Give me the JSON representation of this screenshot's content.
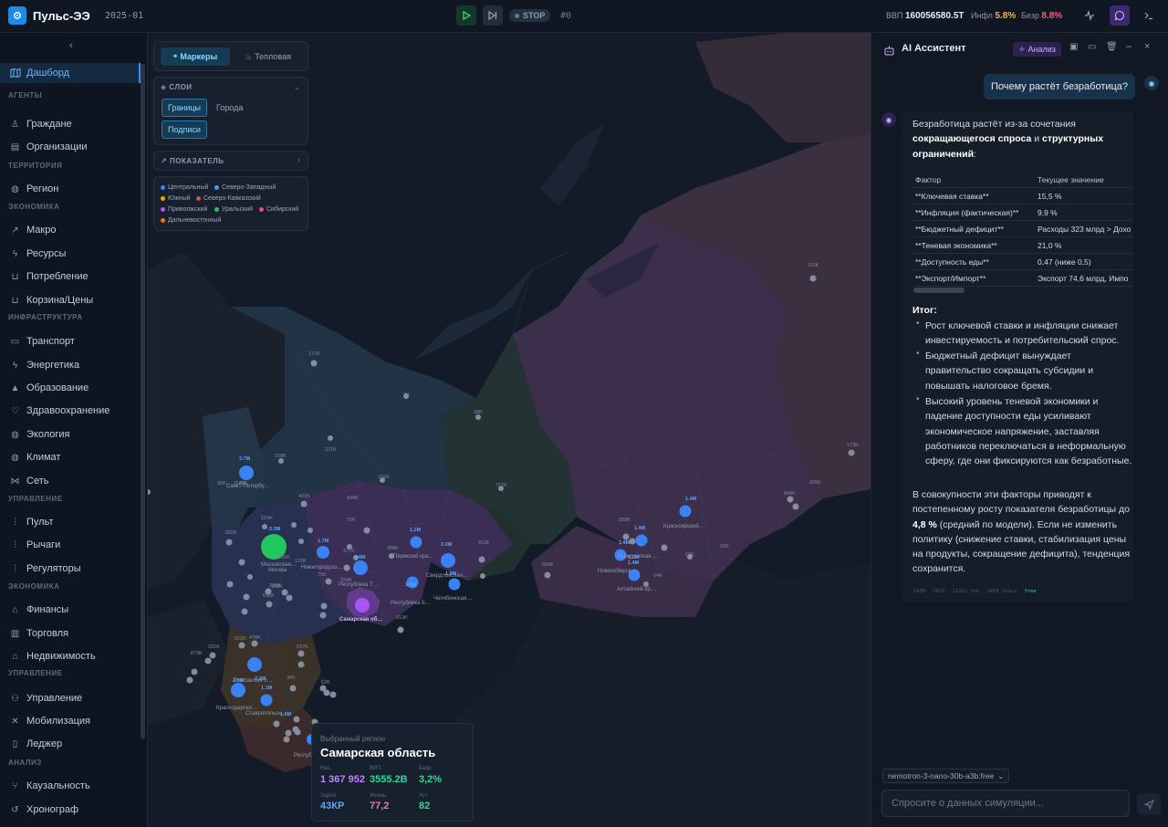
{
  "app": {
    "name": "Пульс-ЭЭ",
    "period": "2025-01",
    "stop_label": "STOP",
    "tick": "#0"
  },
  "stats": {
    "gdp_label": "ВВП",
    "gdp_value": "160056580.5T",
    "infl_label": "Инфл",
    "infl_value": "5.8%",
    "unemp_label": "Безр",
    "unemp_value": "8.8%"
  },
  "colors": {
    "accent": "#1d8ce8",
    "infl": "#f3b63a",
    "unemp": "#ff5a7a",
    "play": "#3bd671",
    "active_nav": "#6fb5ff"
  },
  "sidebar": {
    "active": {
      "label": "Дашборд",
      "icon": "map-icon"
    },
    "sections": [
      {
        "title": "АГЕНТЫ",
        "items": [
          {
            "label": "Граждане",
            "icon": "person-icon"
          },
          {
            "label": "Организации",
            "icon": "building-icon"
          }
        ]
      },
      {
        "title": "ТЕРРИТОРИЯ",
        "items": [
          {
            "label": "Регион",
            "icon": "globe-icon"
          }
        ]
      },
      {
        "title": "ЭКОНОМИКА",
        "items": [
          {
            "label": "Макро",
            "icon": "trend-icon"
          },
          {
            "label": "Ресурсы",
            "icon": "bolt-icon"
          },
          {
            "label": "Потребление",
            "icon": "cart-icon"
          },
          {
            "label": "Корзина/Цены",
            "icon": "cart-icon"
          }
        ]
      },
      {
        "title": "ИНФРАСТРУКТУРА",
        "items": [
          {
            "label": "Транспорт",
            "icon": "truck-icon"
          },
          {
            "label": "Энергетика",
            "icon": "bolt-icon"
          },
          {
            "label": "Образование",
            "icon": "cap-icon"
          },
          {
            "label": "Здравоохранение",
            "icon": "heart-icon"
          },
          {
            "label": "Экология",
            "icon": "globe-icon"
          },
          {
            "label": "Климат",
            "icon": "globe-icon"
          },
          {
            "label": "Сеть",
            "icon": "share-icon"
          }
        ]
      },
      {
        "title": "УПРАВЛЕНИЕ",
        "items": [
          {
            "label": "Пульт",
            "icon": "sliders-icon"
          },
          {
            "label": "Рычаги",
            "icon": "sliders-icon"
          },
          {
            "label": "Регуляторы",
            "icon": "sliders-icon"
          }
        ]
      },
      {
        "title": "ЭКОНОМИКА",
        "items": [
          {
            "label": "Финансы",
            "icon": "bank-icon"
          },
          {
            "label": "Торговля",
            "icon": "store-icon"
          },
          {
            "label": "Недвижимость",
            "icon": "house-icon"
          }
        ]
      },
      {
        "title": "УПРАВЛЕНИЕ",
        "items": [
          {
            "label": "Управление",
            "icon": "people-icon"
          },
          {
            "label": "Мобилизация",
            "icon": "swords-icon"
          },
          {
            "label": "Леджер",
            "icon": "book-icon"
          }
        ]
      },
      {
        "title": "АНАЛИЗ",
        "items": [
          {
            "label": "Каузальность",
            "icon": "branch-icon"
          },
          {
            "label": "Хронограф",
            "icon": "history-icon"
          },
          {
            "label": "Ретроспектива",
            "icon": "clock-icon"
          }
        ]
      }
    ]
  },
  "map": {
    "mode_tabs": [
      {
        "label": "Маркеры",
        "active": true
      },
      {
        "label": "Тепловая",
        "active": false
      }
    ],
    "layers": {
      "title": "СЛОИ",
      "chips": [
        {
          "label": "Границы",
          "active": true
        },
        {
          "label": "Города",
          "active": false
        },
        {
          "label": "Подписи",
          "active": true
        }
      ]
    },
    "indicator": {
      "title": "ПОКАЗАТЕЛЬ"
    },
    "legend": [
      {
        "label": "Центральный",
        "color": "#3b82f6"
      },
      {
        "label": "Северо-Западный",
        "color": "#3aa0ff"
      },
      {
        "label": "Южный",
        "color": "#f59e0b"
      },
      {
        "label": "Северо-Кавказский",
        "color": "#ef4444"
      },
      {
        "label": "Приволжский",
        "color": "#a855f7"
      },
      {
        "label": "Уральский",
        "color": "#22c55e"
      },
      {
        "label": "Сибирский",
        "color": "#ec4899"
      },
      {
        "label": "Дальневосточный",
        "color": "#f97316"
      }
    ],
    "city_labels": [
      "Санкт-Петербу…",
      "Московская…",
      "Москва",
      "Нижегородска…",
      "Республика Т…",
      "Пермский кра…",
      "Свердловская…",
      "Республика Б…",
      "Челябинская…",
      "Самарская об…",
      "Кемеровская …",
      "Новосибирск…",
      "Алтайский кр…",
      "Красноярский…",
      "Ростовская о…",
      "Краснодарски…",
      "Ставропольск…",
      "Республ"
    ],
    "value_labels": [
      "171K",
      "1K",
      "38K",
      "221K",
      "108K",
      "225K",
      "777K",
      "409K",
      "314K",
      "690K",
      "219K",
      "3.7M",
      "69K",
      "90K",
      "72K",
      "1.2M",
      "2.0M",
      "411K",
      "398K",
      "377K",
      "1.7M",
      "4.4M",
      "5.3M",
      "226K",
      "122K",
      "79K",
      "334K",
      "1.8M",
      "1.9M",
      "158K",
      "295K",
      "635K",
      "555K",
      "813K",
      "289K",
      "1.4M",
      "1.4M",
      "1.4M",
      "1.2M",
      "27K",
      "20K",
      "556K",
      "14K",
      "849K",
      "205K",
      "173K",
      "311K",
      "915K",
      "478K",
      "331K",
      "637K",
      "2.2M",
      "2.8M",
      "1.1M",
      "36K",
      "53K",
      "673K",
      "1.4M",
      "1.5M"
    ],
    "selected": {
      "caption": "Выбранный регион",
      "name": "Самарская область",
      "metrics": [
        {
          "label": "Нас.",
          "value": "1 367 952",
          "color": "#c084fc"
        },
        {
          "label": "ВРП",
          "value": "3555.2B",
          "color": "#34d399"
        },
        {
          "label": "Безр.",
          "value": "3,2%",
          "color": "#34d399"
        },
        {
          "label": "Зарпл.",
          "value": "43КР",
          "color": "#60a5fa"
        },
        {
          "label": "Жизнь",
          "value": "77,2",
          "color": "#f472b6"
        },
        {
          "label": "Уст.",
          "value": "82",
          "color": "#34d399"
        }
      ]
    }
  },
  "chat": {
    "title": "AI Ассистент",
    "analysis_label": "Анализ",
    "user_message": "Почему растёт безработица?",
    "intro_1": "Безработица растёт из-за сочетания",
    "intro_b1": "сокращающегося спроса",
    "intro_and": "и",
    "intro_b2": "структурных",
    "intro_b3": "ограничений",
    "intro_colon": ":",
    "table": {
      "headers": [
        "Фактор",
        "Текущее значение"
      ],
      "rows": [
        [
          "**Ключевая ставка**",
          "15,5 %"
        ],
        [
          "**Инфляция (фактическая)**",
          "9,9 %"
        ],
        [
          "**Бюджетный дефицит**",
          "Расходы 323 млрд > Дохо"
        ],
        [
          "**Теневая экономика**",
          "21,0 %"
        ],
        [
          "**Доступность еды**",
          "0,47 (ниже 0,5)"
        ],
        [
          "**Экспорт/Импорт**",
          "Экспорт 74,6 млрд, Импо"
        ]
      ]
    },
    "summary_title": "Итог:",
    "bullets": [
      "Рост ключевой ставки и инфляции снижает инвестируемость и потребительский спрос.",
      "Бюджетный дефицит вынуждает правительство сокращать субсидии и повышать налоговое бремя.",
      "Высокий уровень теневой экономики и падение доступности еды усиливают экономическое напряжение, заставляя работников переключаться в неформальную сферу, где они фиксируются как безработные."
    ],
    "conclusion_1": "В совокупности эти факторы приводят к постепенному росту показателя безработицы до",
    "conclusion_value": "4,8 %",
    "conclusion_2": "(средний по модели). Если не изменить политику (снижение ставки, стабилизация цены на продукты, сокращение дефицита), тенденция сохранится.",
    "meta": [
      "1409",
      "5623",
      "11322 tok",
      "1668 chars",
      "free"
    ],
    "model": "nemotron-3-nano-30b-a3b:free",
    "input_placeholder": "Спросите о данных симуляции..."
  }
}
